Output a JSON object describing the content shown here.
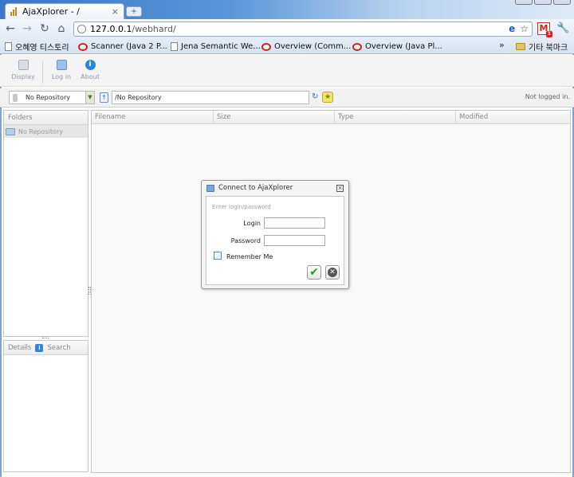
{
  "browser": {
    "tab_title": "AjaXplorer - /",
    "tab_close": "×",
    "new_tab": "+",
    "url_host": "127.0.0.1",
    "url_path": "/webhard/",
    "bookmarks": [
      {
        "label": "오혜영 티스토리",
        "icon": "page-icon"
      },
      {
        "label": "Scanner (Java 2 P...",
        "icon": "oracle-icon"
      },
      {
        "label": "Jena Semantic We...",
        "icon": "page-icon"
      },
      {
        "label": "Overview (Comm...",
        "icon": "oracle-icon"
      },
      {
        "label": "Overview (Java Pl...",
        "icon": "oracle-icon"
      }
    ],
    "bookmarks_overflow": "»",
    "other_bookmarks": "기타 북마크"
  },
  "toolbar": {
    "display_label": "Display",
    "login_label": "Log in",
    "about_label": "About",
    "about_icon_glyph": "i"
  },
  "location": {
    "repository": "No Repository",
    "path": "/No Repository",
    "status": "Not logged in."
  },
  "folders_panel": {
    "header": "Folders",
    "item": "No Repository"
  },
  "details_panel": {
    "details_label": "Details",
    "search_label": "Search"
  },
  "file_list": {
    "columns": [
      "Filename",
      "Size",
      "Type",
      "Modified"
    ]
  },
  "login_dialog": {
    "title": "Connect to AjaXplorer",
    "hint": "Enter login/password",
    "login_label": "Login",
    "password_label": "Password",
    "remember_label": "Remember Me",
    "login_value": "",
    "password_value": ""
  },
  "colors": {
    "chrome_accent": "#3a78c3",
    "folder_selected_bg": "#e6e6e6",
    "ok_green": "#2a9a2a"
  }
}
